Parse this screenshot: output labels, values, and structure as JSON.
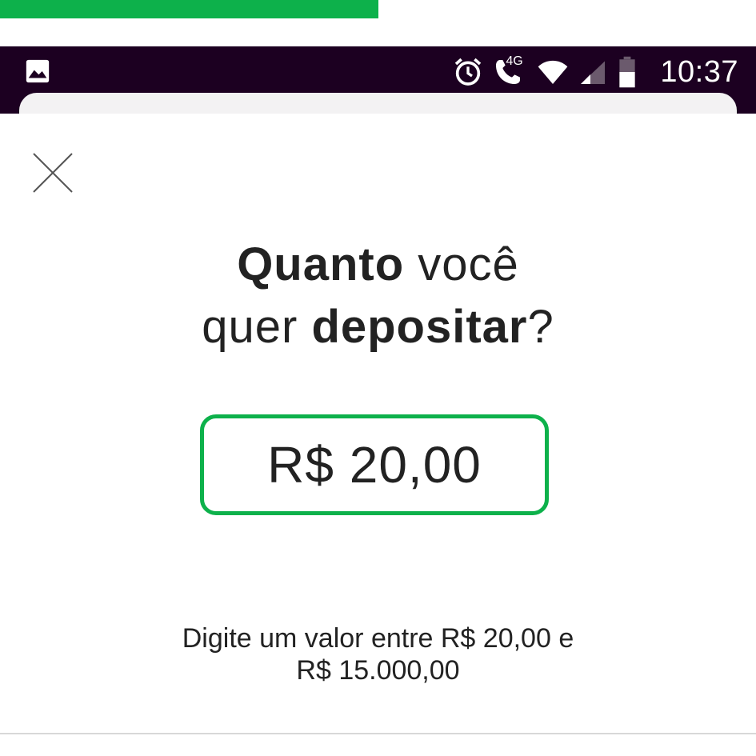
{
  "progress": {
    "fraction": 0.5,
    "color": "#0db14b"
  },
  "status_bar": {
    "time": "10:37",
    "network_label": "4G",
    "left_icon": "image-icon",
    "icons": [
      "alarm-icon",
      "wifi-call-icon",
      "wifi-icon",
      "signal-icon",
      "battery-icon"
    ],
    "background": "#1c0021"
  },
  "sheet": {
    "close_icon": "close-icon",
    "question": {
      "part1_bold": "Quanto",
      "part2": " você",
      "part3": "quer ",
      "part4_bold": "depositar",
      "part5": "?"
    },
    "amount": {
      "value": "R$ 20,00",
      "border_color": "#0db14b"
    },
    "helper": {
      "line1": "Digite um valor entre R$ 20,00 e",
      "line2": "R$ 15.000,00"
    }
  }
}
